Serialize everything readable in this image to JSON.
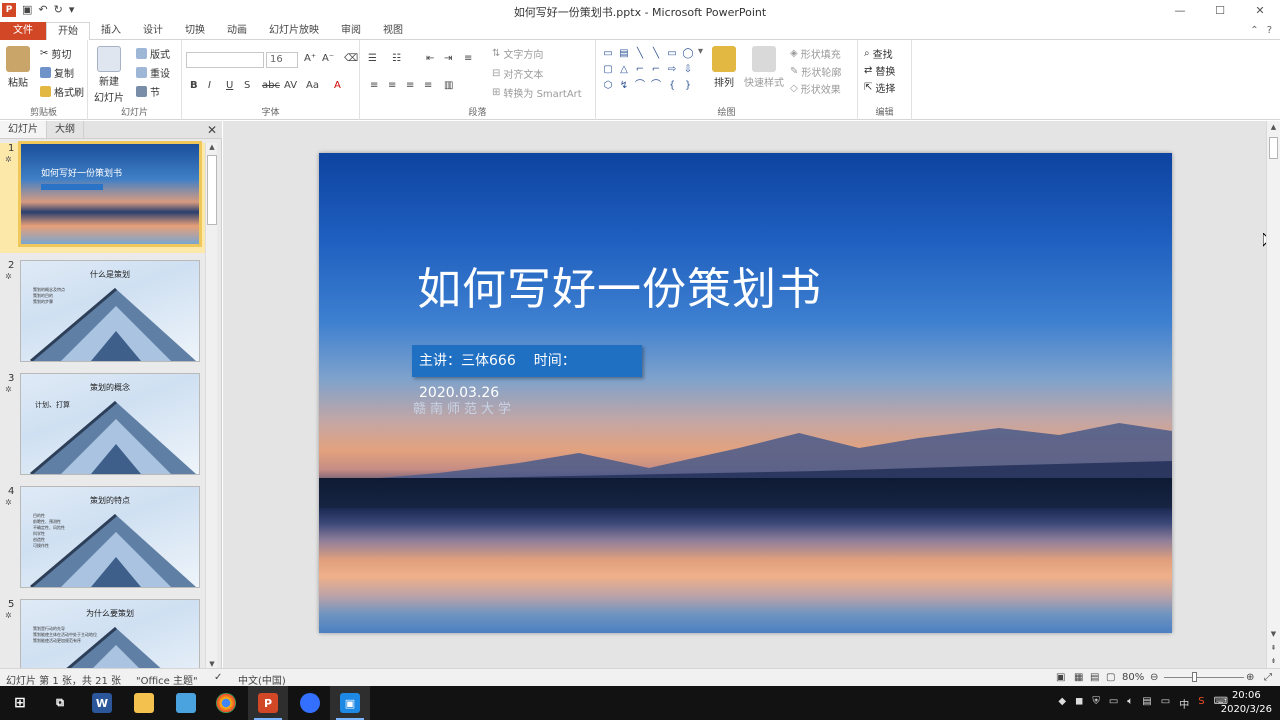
{
  "window": {
    "title": "如何写好一份策划书.pptx - Microsoft PowerPoint",
    "app_logo": "P",
    "controls": [
      "minimize-icon",
      "maximize-icon",
      "close-icon"
    ]
  },
  "qat": [
    "save-icon",
    "undo-icon",
    "redo-icon",
    "customize-icon"
  ],
  "tabs": [
    "文件",
    "开始",
    "插入",
    "设计",
    "切换",
    "动画",
    "幻灯片放映",
    "审阅",
    "视图"
  ],
  "ribbon": {
    "clipboard": {
      "label": "剪贴板",
      "paste": "粘贴",
      "cut": "剪切",
      "copy": "复制",
      "format_painter": "格式刷"
    },
    "slides": {
      "label": "幻灯片",
      "new_slide": "新建\n幻灯片",
      "new_slide_line1": "新建",
      "new_slide_line2": "幻灯片",
      "layout": "版式",
      "reset": "重设",
      "section": "节"
    },
    "font": {
      "label": "字体",
      "font_name": "",
      "font_size": "16",
      "buttons": [
        "B",
        "I",
        "U",
        "S",
        "abc",
        "AV",
        "Aa",
        "A"
      ]
    },
    "paragraph": {
      "label": "段落",
      "text_direction": "文字方向",
      "align_text": "对齐文本",
      "convert_smartart": "转换为 SmartArt"
    },
    "drawing": {
      "label": "绘图",
      "arrange": "排列",
      "quick_styles": "快速样式",
      "shape_fill": "形状填充",
      "shape_outline": "形状轮廓",
      "shape_effects": "形状效果"
    },
    "editing": {
      "label": "编辑",
      "find": "查找",
      "replace": "替换",
      "select": "选择"
    }
  },
  "left_pane": {
    "tabs": [
      "幻灯片",
      "大纲"
    ],
    "slides": [
      {
        "num": "1",
        "title": "如何写好一份策划书",
        "selected": true
      },
      {
        "num": "2",
        "title": "什么是策划",
        "bullets": [
          "策划的概念及特点",
          "策划的目的",
          "策划的步骤"
        ]
      },
      {
        "num": "3",
        "title": "策划的概念",
        "subtitle": "计划、打算"
      },
      {
        "num": "4",
        "title": "策划的特点",
        "bullets": [
          "目的性",
          "前瞻性、预测性",
          "不确定性、风险性",
          "科学性",
          "创造性",
          "可操作性"
        ]
      },
      {
        "num": "5",
        "title": "为什么要策划",
        "bullets": [
          "策划是行动的先导",
          "策划能使主体在活动中处于主动地位",
          "策划能使活动更加规范有序"
        ]
      }
    ]
  },
  "slide": {
    "title": "如何写好一份策划书",
    "presenter": "主讲：三体666",
    "time": "时间：2020.03.26",
    "school": "赣南师范大学"
  },
  "status": {
    "slide_info": "幻灯片 第 1 张，共 21 张",
    "theme": "\"Office 主题\"",
    "language": "中文(中国)",
    "zoom": "80%",
    "zoom_level": 0.8
  },
  "taskbar": {
    "apps": [
      "windows-start",
      "task-view",
      "word",
      "file-explorer",
      "network",
      "chrome",
      "powerpoint",
      "feishu",
      "screen-recorder"
    ],
    "tray_text": "中",
    "time": "20:06",
    "date": "2020/3/26"
  },
  "colors": {
    "accent": "#d24726",
    "slide_tag": "#1f6fc2",
    "selected_thumb": "#f0c75a"
  }
}
